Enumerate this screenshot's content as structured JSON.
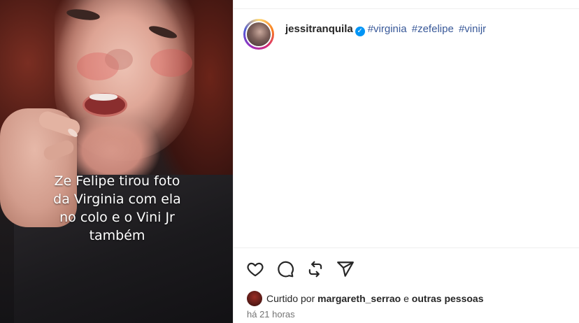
{
  "video": {
    "caption_lines": [
      "Ze Felipe tirou foto",
      "da Virginia com ela",
      "no colo e o Vini Jr",
      "também"
    ]
  },
  "post": {
    "username": "jessitranquila",
    "verified_icon": "verified-badge-icon",
    "hashtags": [
      "#virginia",
      "#zefelipe",
      "#vinijr"
    ],
    "colors": {
      "link": "#385898",
      "verified": "#0095f6",
      "muted": "#737373"
    }
  },
  "actions": {
    "icons": [
      "heart-icon",
      "comment-icon",
      "repost-icon",
      "share-icon"
    ]
  },
  "likes": {
    "prefix": "Curtido por",
    "user": "margareth_serrao",
    "conjunction": "e",
    "others": "outras pessoas"
  },
  "timestamp": "há 21 horas"
}
